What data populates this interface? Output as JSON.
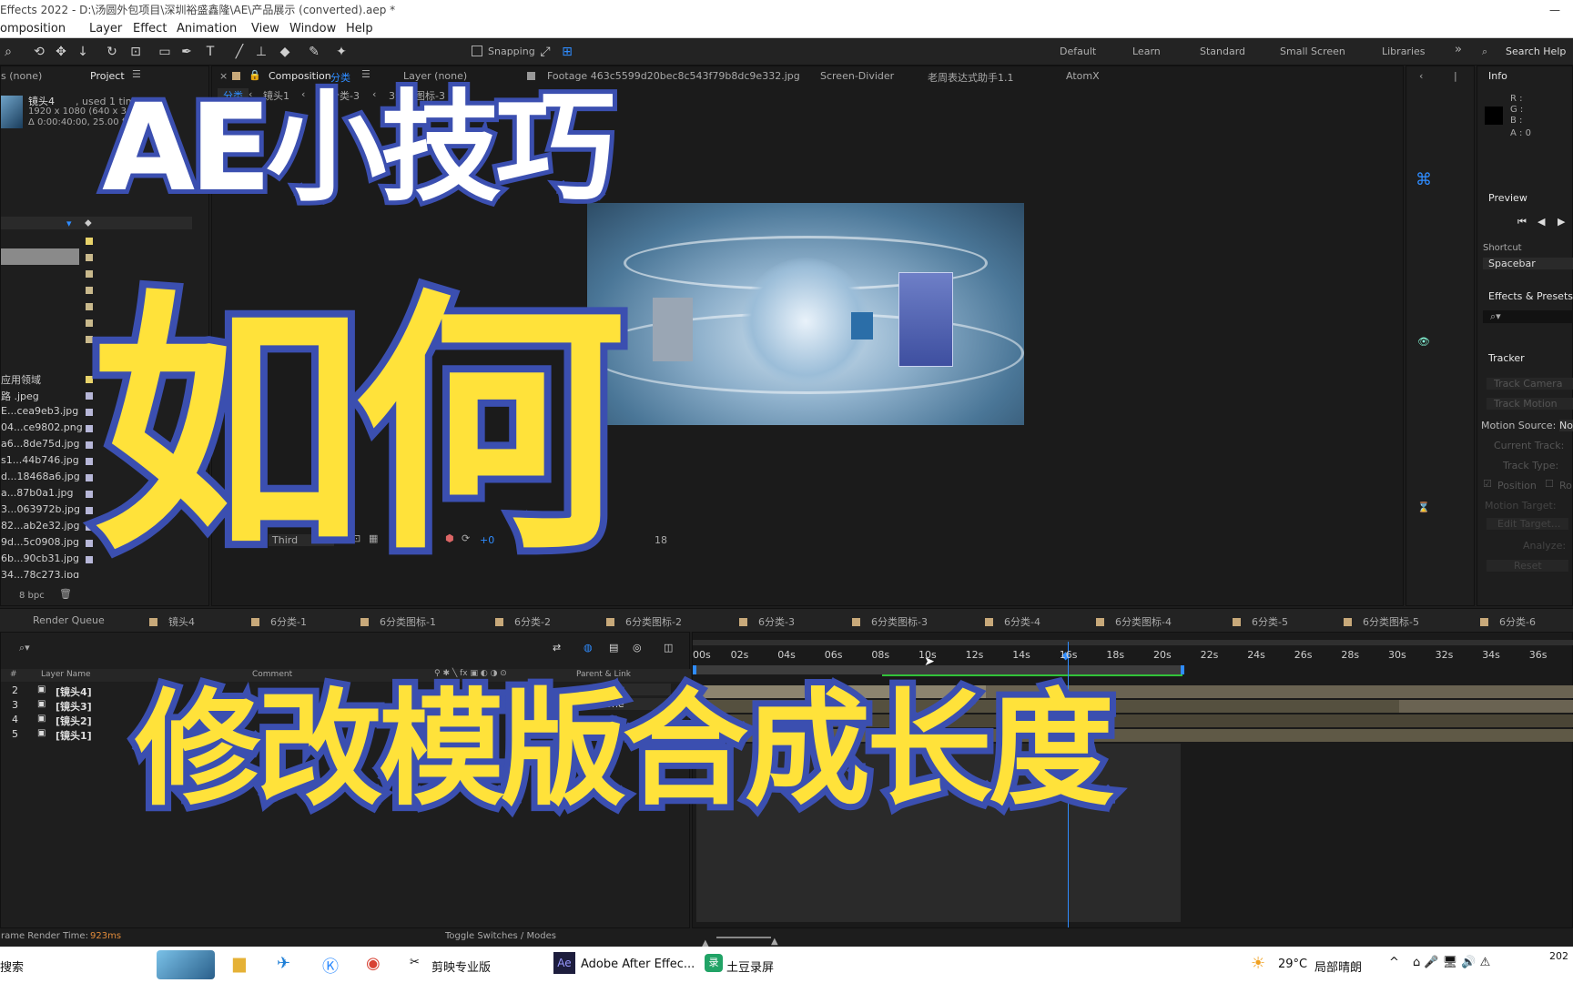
{
  "title_bar": {
    "text": "Effects 2022 - D:\\汤圆外包项目\\深圳裕盛鑫隆\\AE\\产品展示 (converted).aep *",
    "minimize": "—"
  },
  "menu": [
    "omposition",
    "Layer",
    "Effect",
    "Animation",
    "View",
    "Window",
    "Help"
  ],
  "toolbar": {
    "snapping_label": "Snapping",
    "workspaces": [
      "Default",
      "Learn",
      "Standard",
      "Small Screen",
      "Libraries"
    ],
    "more": "»",
    "search_help": "Search Help"
  },
  "project_panel": {
    "tab_effects": "s (none)",
    "tab_project": "Project",
    "item_name": "镜头4",
    "used": ", used 1 time",
    "res": "1920 x 1080  (640 x 360) (1",
    "duration": "Δ 0:00:40:00, 25.00 fps",
    "files": [
      "应用领域",
      "路 .jpeg",
      "E...cea9eb3.jpg",
      "04...ce9802.png",
      "a6...8de75d.jpg",
      "s1...44b746.jpg",
      "d...18468a6.jpg",
      "a...87b0a1.jpg",
      "3...063972b.jpg",
      "82...ab2e32.jpg",
      "9d...5c0908.jpg",
      "6b...90cb31.jpg",
      "34...78c273.jpg"
    ],
    "bpc": "8 bpc"
  },
  "viewer": {
    "tab_composition": "Composition",
    "comp_name": "分类",
    "tab_layer": "Layer (none)",
    "tab_footage": "Footage 463c5599d20bec8c543f79b8dc9e332.jpg",
    "tab_screen_divider": "Screen-Divider",
    "tab_helper": "老周表达式助手1.1",
    "tab_atomx": "AtomX",
    "breadcrumbs": [
      "分类",
      "镜头1",
      "三分类-3",
      "3分类图标-3"
    ],
    "resolution": "Third",
    "time_readout": "+0",
    "frame": "18"
  },
  "info_panel": {
    "title": "Info",
    "r": "R :",
    "g": "G :",
    "b": "B :",
    "a": "A :  0"
  },
  "preview_panel": {
    "title": "Preview",
    "shortcut_label": "Shortcut",
    "shortcut_value": "Spacebar"
  },
  "effects_panel": {
    "title": "Effects & Presets"
  },
  "tracker_panel": {
    "title": "Tracker",
    "track_camera": "Track Camera",
    "track_motion": "Track Motion",
    "motion_source_label": "Motion Source:",
    "motion_source_value": "No",
    "current_track": "Current Track:",
    "track_type": "Track Type:",
    "position": "Position",
    "rotation": "Ro",
    "motion_target": "Motion Target:",
    "edit_target": "Edit Target...",
    "analyze": "Analyze:",
    "reset": "Reset"
  },
  "timeline_tabs": [
    "Render Queue",
    "镜头4",
    "6分类-1",
    "6分类图标-1",
    "6分类-2",
    "6分类图标-2",
    "6分类-3",
    "6分类图标-3",
    "6分类-4",
    "6分类图标-4",
    "6分类-5",
    "6分类图标-5",
    "6分类-6"
  ],
  "timeline": {
    "col_layer_name": "Layer Name",
    "col_comment": "Comment",
    "col_parent": "Parent & Link",
    "ruler": [
      "00s",
      "02s",
      "04s",
      "06s",
      "08s",
      "10s",
      "12s",
      "14s",
      "16s",
      "18s",
      "20s",
      "22s",
      "24s",
      "26s",
      "28s",
      "30s",
      "32s",
      "34s",
      "36s"
    ],
    "layers": [
      {
        "num": "2",
        "name": "[镜头4]",
        "parent": "None"
      },
      {
        "num": "3",
        "name": "[镜头3]",
        "parent": "None"
      },
      {
        "num": "4",
        "name": "[镜头2]",
        "parent": ""
      },
      {
        "num": "5",
        "name": "[镜头1]",
        "parent": ""
      }
    ],
    "frame_render_label": "rame Render Time:",
    "frame_render_value": "923ms",
    "toggle_label": "Toggle Switches / Modes"
  },
  "overlay": {
    "line1": "AE小技巧",
    "line2": "如何",
    "line3": "修改模版合成长度",
    "fill_white": "#ffffff",
    "fill_yellow": "#ffe23a",
    "outline": "#3b4fb0"
  },
  "taskbar": {
    "search": "搜索",
    "app_jianying": "剪映专业版",
    "app_ae": "Adobe After Effec...",
    "app_tudou": "土豆录屏",
    "weather_temp": "29°C",
    "weather_desc": "局部晴朗",
    "year": "202"
  }
}
